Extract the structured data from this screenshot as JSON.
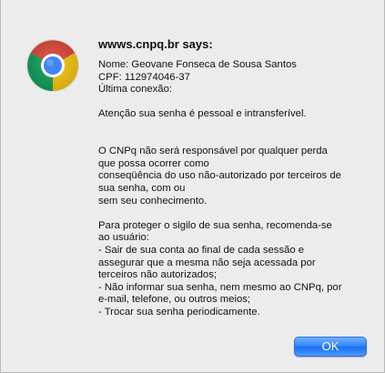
{
  "dialog": {
    "title": "wwws.cnpq.br says:",
    "icon": "chrome-logo-icon",
    "lines": [
      "Nome: Geovane Fonseca de Sousa Santos",
      "CPF: 112974046-37",
      "Última conexão:",
      "",
      "Atenção sua senha é pessoal e intransferível.",
      "",
      "",
      "O CNPq não será responsável por qualquer perda",
      "que possa ocorrer como",
      "conseqüência do uso não-autorizado por terceiros de",
      "sua senha, com ou",
      "sem seu conhecimento.",
      "",
      "Para proteger o sigilo de sua senha, recomenda-se",
      "ao usuário:",
      "- Sair de sua conta ao final de cada sessão e",
      "assegurar que a mesma não seja acessada por",
      "terceiros não autorizados;",
      "- Não informar sua senha, nem mesmo ao CNPq, por",
      "e-mail, telefone, ou outros meios;",
      "- Trocar sua senha periodicamente."
    ],
    "ok_label": "OK"
  },
  "colors": {
    "background": "#ececec",
    "button": "#2d82fb"
  }
}
